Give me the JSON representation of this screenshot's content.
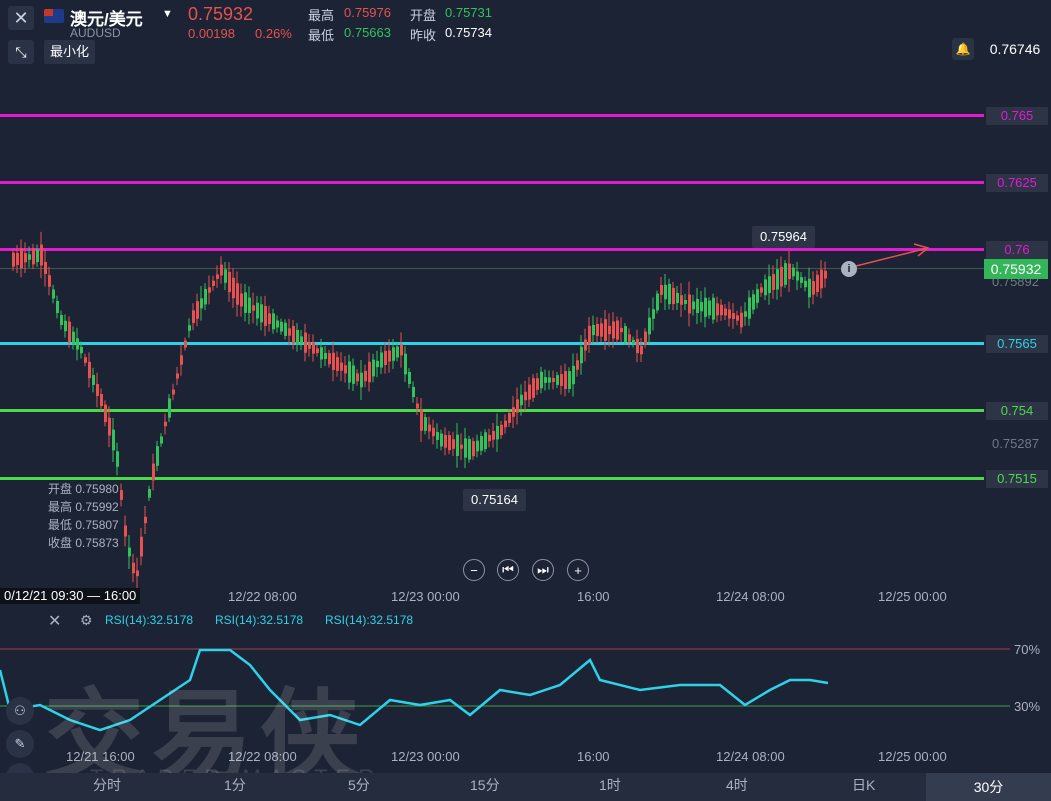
{
  "header": {
    "symbol_name": "澳元/美元",
    "symbol_code": "AUDUSD",
    "price": "0.75932",
    "change": "0.00198",
    "change_pct": "0.26%",
    "high_label": "最高",
    "high_value": "0.75976",
    "open_label": "开盘",
    "open_value": "0.75731",
    "low_label": "最低",
    "low_value": "0.75663",
    "prev_label": "昨收",
    "prev_value": "0.75734",
    "minimize_label": "最小化"
  },
  "alert_price": "0.76746",
  "price_levels": [
    {
      "label": "0.765",
      "color": "#e21bd3"
    },
    {
      "label": "0.7625",
      "color": "#e21bd3"
    },
    {
      "label": "0.76",
      "color": "#e21bd3"
    },
    {
      "label": "0.7565",
      "color": "#2ed2e8"
    },
    {
      "label": "0.754",
      "color": "#4cd94c"
    },
    {
      "label": "0.7515",
      "color": "#4cd94c"
    }
  ],
  "current_price_tag": "0.75932",
  "gray_prices": [
    "0.75892",
    "0.75287"
  ],
  "callouts": {
    "high": "0.75964",
    "low": "0.75164"
  },
  "ohlc_box": [
    "开盘 0.75980",
    "最高 0.75992",
    "最低 0.75807",
    "收盘 0.75873"
  ],
  "x_axis_main": [
    "12/22 08:00",
    "12/23 00:00",
    "16:00",
    "12/24 08:00",
    "12/25 00:00"
  ],
  "crosshair_time": "0/12/21 09:30 — 16:00",
  "rsi": {
    "labels": [
      "RSI(14):32.5178",
      "RSI(14):32.5178",
      "RSI(14):32.5178"
    ],
    "upper": "70%",
    "lower": "30%"
  },
  "x_axis_rsi": [
    "12/21 16:00",
    "12/22 08:00",
    "12/23 00:00",
    "16:00",
    "12/24 08:00",
    "12/25 00:00"
  ],
  "timeframes": [
    "分时",
    "1分",
    "5分",
    "15分",
    "1时",
    "4时",
    "日K"
  ],
  "timeframe_active": "30分",
  "watermark": "交易侠",
  "watermark_sub": "TRADER MASTER",
  "colors": {
    "up": "#33c25a",
    "down": "#e8514e",
    "rsi": "#2ed2e8",
    "bg": "#1c2334"
  }
}
